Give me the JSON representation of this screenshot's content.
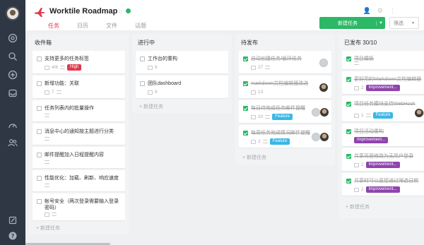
{
  "header": {
    "title": "Worktile Roadmap",
    "tabs": [
      "任务",
      "日历",
      "文件",
      "话题"
    ],
    "new_task_button": "新建任务",
    "filter_button": "筛选"
  },
  "colors": {
    "brand": "#e2384d",
    "green": "#2cb867",
    "high": "#e2384d",
    "feature": "#3ab7e8",
    "improvement": "#8e44ad",
    "sidebar": "#2f3744"
  },
  "columns": [
    {
      "title": "收件箱",
      "add_label": "+ 新建任务",
      "cards": [
        {
          "title": "支持更多的任务标签",
          "count": "4/6",
          "badge": "High"
        },
        {
          "title": "新增功能：关联",
          "count": "7"
        },
        {
          "title": "任务列表内的批量操作",
          "count": ""
        },
        {
          "title": "消息中心的通知按主题进行分类",
          "count": ""
        },
        {
          "title": "邮件提醒加入日程提醒内容",
          "count": ""
        },
        {
          "title": "性能优化：加载、刷新、响应速度",
          "count": ""
        },
        {
          "title": "帐号安全（两次登录需要输入登录密码）",
          "count": ""
        }
      ]
    },
    {
      "title": "进行中",
      "add_label": "+ 新建任务",
      "cards": [
        {
          "title": "工作台的重构",
          "count": "9"
        },
        {
          "title": "团队dashboard",
          "count": "9"
        }
      ]
    },
    {
      "title": "待发布",
      "add_label": "+ 新建任务",
      "cards": [
        {
          "title": "自动创建任务/循环任务",
          "count": "27"
        },
        {
          "title": "markdown文档编辑器改进",
          "count": "13"
        },
        {
          "title": "每日待完成任务邮件提醒",
          "count": "10",
          "badge": "Feature"
        },
        {
          "title": "每周任务完成情况邮件提醒",
          "count": "2",
          "badge": "Feature"
        }
      ]
    },
    {
      "title": "已发布 30/10",
      "add_label": "+ 新建任务",
      "cards": [
        {
          "title": "项目模板",
          "count": ""
        },
        {
          "title": "更好用的Markdown文档编辑器",
          "count": "2",
          "badge": "Improvement..."
        },
        {
          "title": "项目任务模块支持WebHook",
          "count": "1",
          "badge": "Feature"
        },
        {
          "title": "项目活动重构",
          "count": "",
          "badge": "Improvement..."
        },
        {
          "title": "共享页面修改为无用户登录",
          "count": "2",
          "badge": "Improvement..."
        },
        {
          "title": "共享时可以直接通过筛选日期",
          "count": "2",
          "badge": "Improvement..."
        }
      ]
    }
  ]
}
